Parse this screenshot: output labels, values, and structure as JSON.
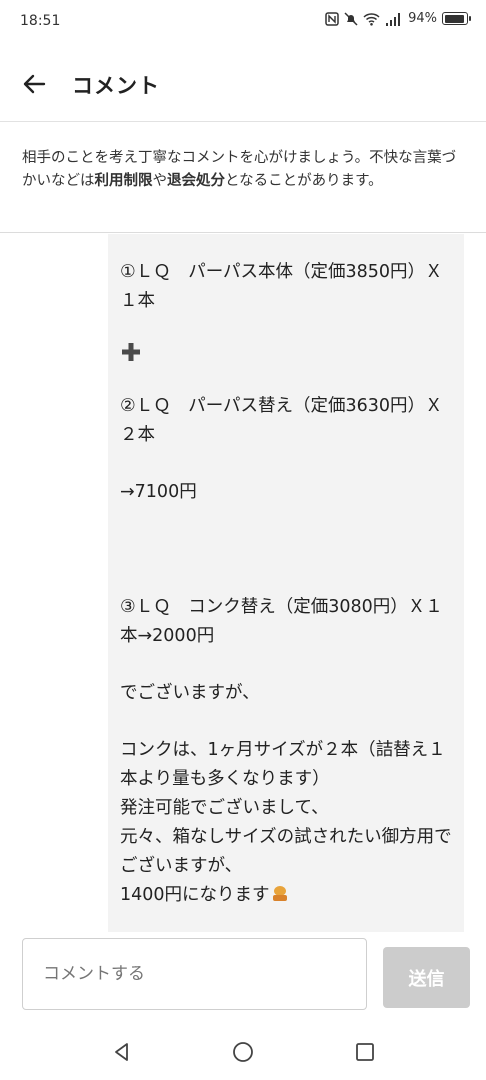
{
  "status_bar": {
    "time": "18:51",
    "battery_percent": "94%",
    "battery_level": 0.94
  },
  "app_bar": {
    "title": "コメント"
  },
  "notice": {
    "part1": "相手のことを考え丁寧なコメントを心がけましょう。不快な言葉づかいなどは",
    "bold1": "利用制限",
    "part2": "や",
    "bold2": "退会処分",
    "part3": "となることがあります。"
  },
  "message": {
    "cut_line": "＊＊＊＊＊＊",
    "lines": [
      "①ＬＱ　パーパス本体（定価3850円）Ｘ１本",
      "②ＬＱ　パーパス替え（定価3630円）Ｘ２本",
      "→7100円",
      "③ＬＱ　コンク替え（定価3080円）Ｘ１本→2000円",
      "でございますが、",
      "コンクは、1ヶ月サイズが２本（詰替え１本より量も多くなります）",
      "発注可能でございまして、",
      "元々、箱なしサイズの試されたい御方用でございますが、",
      "1400円になります"
    ]
  },
  "input": {
    "placeholder": "コメントする"
  },
  "send_button": {
    "label": "送信"
  },
  "colors": {
    "bubble_bg": "#f3f3f3",
    "send_disabled": "#cccccc",
    "bow_emoji": "#e8a33a"
  }
}
